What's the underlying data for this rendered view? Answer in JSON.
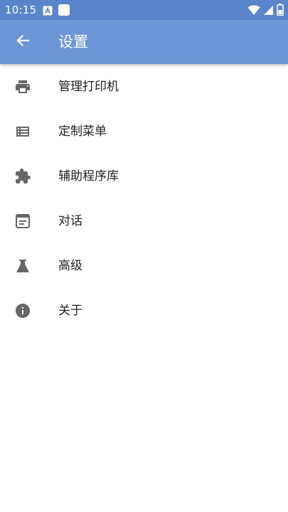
{
  "status_bar": {
    "time": "10:15"
  },
  "app_bar": {
    "title": "设置",
    "back_icon": "arrow-back-icon"
  },
  "colors": {
    "status_bar": "#5b85cb",
    "app_bar": "#6e96d6",
    "icon_gray": "#666666",
    "text": "#222222"
  },
  "menu": {
    "items": [
      {
        "label": "管理打印机",
        "icon": "printer-icon"
      },
      {
        "label": "定制菜单",
        "icon": "list-icon"
      },
      {
        "label": "辅助程序库",
        "icon": "puzzle-icon"
      },
      {
        "label": "对话",
        "icon": "dialog-icon"
      },
      {
        "label": "高级",
        "icon": "flask-icon"
      },
      {
        "label": "关于",
        "icon": "info-icon"
      }
    ]
  }
}
